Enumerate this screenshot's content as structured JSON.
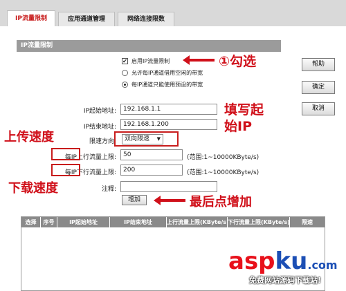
{
  "tabs": [
    "IP流量限制",
    "应用通道管理",
    "网络连接限数"
  ],
  "section_title": "IP流量限制",
  "options": {
    "enable_label": "启用IP流量限制",
    "allow_borrow_label": "允许每IP通道借用空闲的带宽",
    "preset_only_label": "每IP通道只能使用预设的带宽"
  },
  "form": {
    "start_ip_label": "IP起始地址:",
    "start_ip_value": "192.168.1.1",
    "end_ip_label": "IP结束地址:",
    "end_ip_value": "192.168.1.200",
    "direction_label": "限速方向:",
    "direction_value": "双向限速",
    "upload_label_pre": "每IP",
    "upload_label_mid": "上行流量",
    "upload_label_post": "上限:",
    "upload_value": "50",
    "upload_hint": "(范围:1~10000KByte/s)",
    "download_label_pre": "每IP",
    "download_label_mid": "下行流量",
    "download_label_post": "上限:",
    "download_value": "200",
    "download_hint": "(范围:1~10000KByte/s)",
    "note_label": "注释:",
    "note_value": "",
    "add_button": "增加"
  },
  "side_buttons": {
    "help": "帮助",
    "ok": "确定",
    "cancel": "取消"
  },
  "table_headers": [
    "选择",
    "序号",
    "IP起始地址",
    "IP结束地址",
    "上行流量上限(KByte/s)",
    "下行流量上限(KByte/s)",
    "限速"
  ],
  "annotations": {
    "check": "①勾选",
    "fill_start_1": "填写起",
    "fill_start_2": "始IP",
    "upload_speed": "上传速度",
    "download_speed": "下载速度",
    "click_add": "最后点增加"
  },
  "watermark": {
    "asp": "asp",
    "ku": "ku",
    "dot": ".com",
    "sub": "免费网站源码下载站!"
  },
  "colors": {
    "active_tab": "#c81c1c",
    "annotation": "#d0101a",
    "section_bar": "#9b9b9b",
    "table_header": "#8a8a8a"
  }
}
